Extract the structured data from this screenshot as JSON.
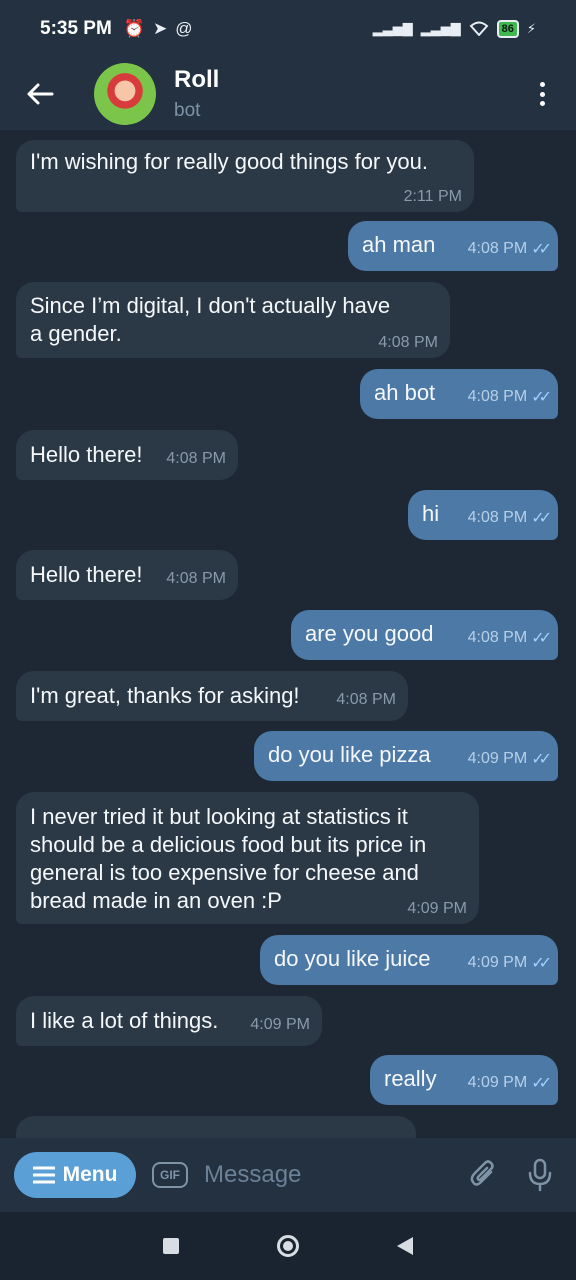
{
  "status_bar": {
    "time": "5:35 PM",
    "battery": "86"
  },
  "header": {
    "title": "Roll",
    "subtitle": "bot"
  },
  "messages": [
    {
      "dir": "in",
      "text": "I'm wishing for really good things for you.",
      "time": "2:11 PM"
    },
    {
      "dir": "out",
      "text": "ah man",
      "time": "4:08 PM"
    },
    {
      "dir": "in",
      "text": "Since I’m digital, I don't actually have a gender.",
      "time": "4:08 PM"
    },
    {
      "dir": "out",
      "text": "ah bot",
      "time": "4:08 PM"
    },
    {
      "dir": "in",
      "text": "Hello there!",
      "time": "4:08 PM"
    },
    {
      "dir": "out",
      "text": "hi",
      "time": "4:08 PM"
    },
    {
      "dir": "in",
      "text": "Hello there!",
      "time": "4:08 PM"
    },
    {
      "dir": "out",
      "text": "are you good",
      "time": "4:08 PM"
    },
    {
      "dir": "in",
      "text": "I'm great, thanks for asking!",
      "time": "4:08 PM"
    },
    {
      "dir": "out",
      "text": "do you like pizza",
      "time": "4:09 PM"
    },
    {
      "dir": "in",
      "text": "I never tried it but looking at statistics it should be a delicious food but its price in general is too expensive for cheese and bread made in an oven :P",
      "time": "4:09 PM"
    },
    {
      "dir": "out",
      "text": "do you like juice",
      "time": "4:09 PM"
    },
    {
      "dir": "in",
      "text": "I like a lot of things.",
      "time": "4:09 PM"
    },
    {
      "dir": "out",
      "text": "really",
      "time": "4:09 PM"
    }
  ],
  "composer": {
    "menu_label": "Menu",
    "gif_label": "GIF",
    "placeholder": "Message"
  },
  "colors": {
    "incoming": "#2b3946",
    "outgoing": "#4d79a6",
    "accent": "#5a9fd6"
  }
}
